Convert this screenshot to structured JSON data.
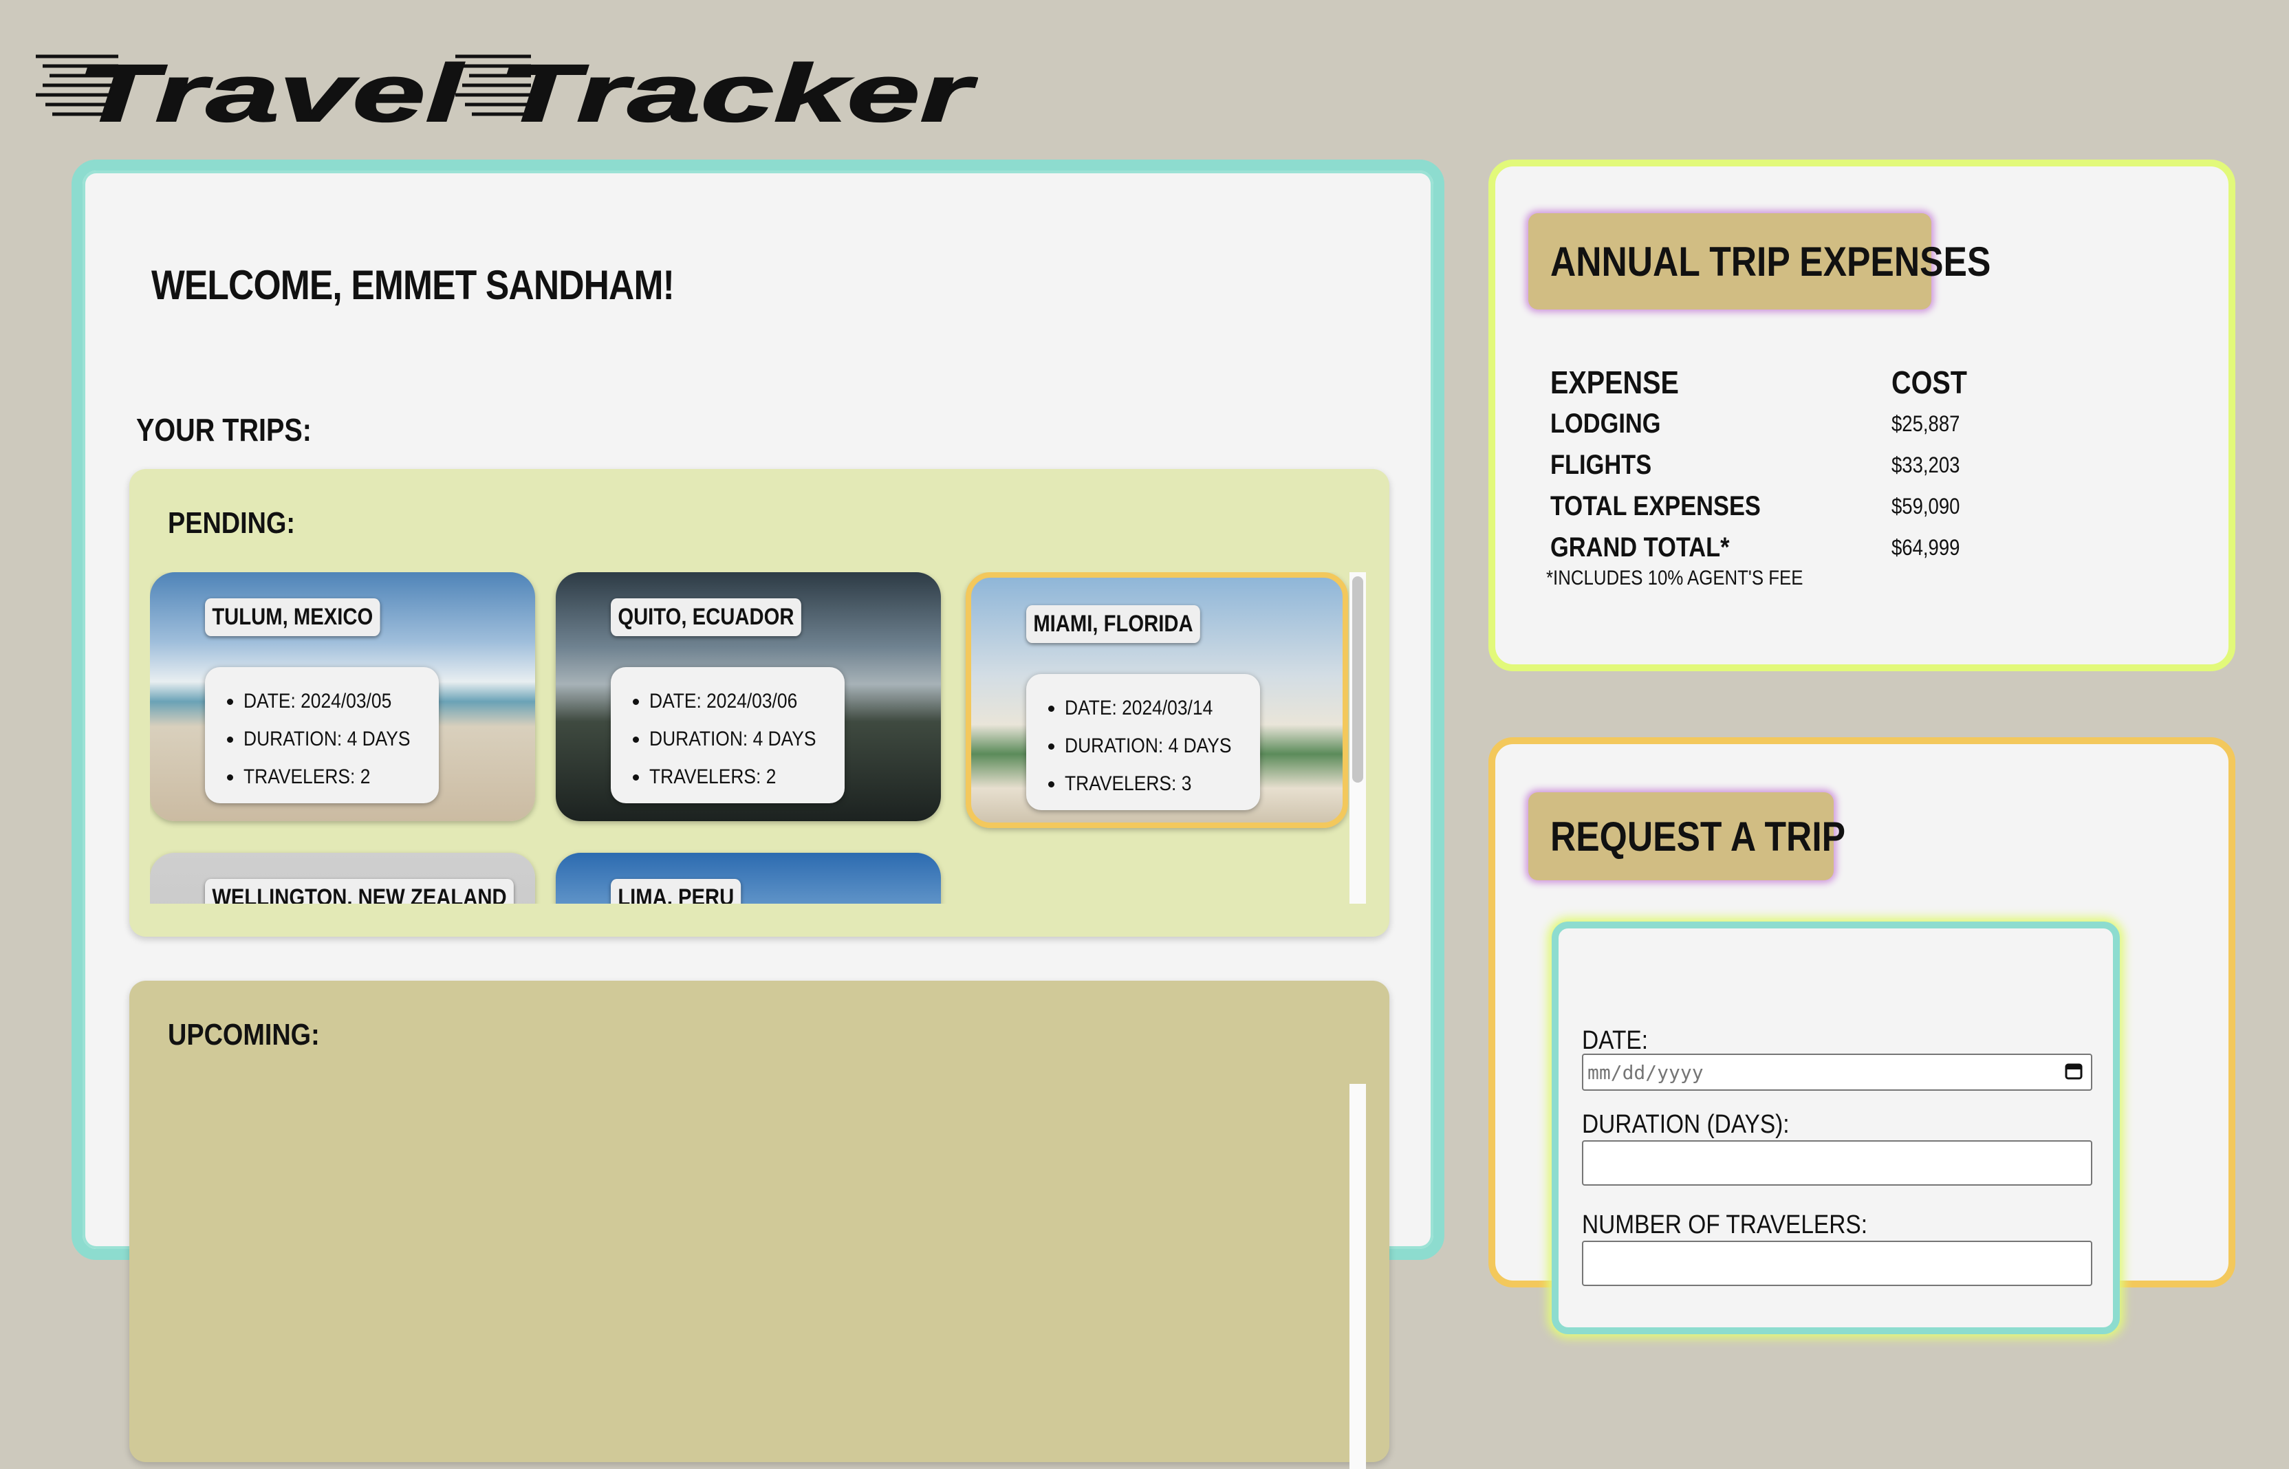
{
  "app": {
    "logo_text": "Travel Tracker"
  },
  "main": {
    "welcome": "WELCOME, EMMET SANDHAM!",
    "your_trips_heading": "YOUR TRIPS:",
    "pending": {
      "title": "PENDING:",
      "trips": [
        {
          "name": "TULUM, MEXICO",
          "date": "DATE: 2024/03/05",
          "duration": "DURATION: 4 DAYS",
          "travelers": "TRAVELERS: 2"
        },
        {
          "name": "QUITO, ECUADOR",
          "date": "DATE: 2024/03/06",
          "duration": "DURATION: 4 DAYS",
          "travelers": "TRAVELERS: 2"
        },
        {
          "name": "MIAMI, FLORIDA",
          "date": "DATE: 2024/03/14",
          "duration": "DURATION: 4 DAYS",
          "travelers": "TRAVELERS: 3"
        },
        {
          "name": "WELLINGTON, NEW ZEALAND"
        },
        {
          "name": "LIMA, PERU"
        }
      ]
    },
    "upcoming": {
      "title": "UPCOMING:"
    }
  },
  "expenses": {
    "title": "ANNUAL TRIP EXPENSES",
    "headers": [
      "EXPENSE",
      "COST"
    ],
    "rows": [
      {
        "label": "LODGING",
        "value": "$25,887"
      },
      {
        "label": "FLIGHTS",
        "value": "$33,203"
      },
      {
        "label": "TOTAL EXPENSES",
        "value": "$59,090"
      },
      {
        "label": "GRAND TOTAL*",
        "value": "$64,999"
      }
    ],
    "note": "*INCLUDES 10% AGENT'S FEE"
  },
  "request": {
    "title": "REQUEST A TRIP",
    "date_label": "DATE:",
    "date_placeholder": "mm/dd/yyyy",
    "duration_label": "DURATION (DAYS):",
    "travelers_label": "NUMBER OF TRAVELERS:"
  },
  "colors": {
    "background": "#cdc9bd",
    "main_border": "#8ddccf",
    "expenses_border": "#e2f97a",
    "request_border": "#f3c85c",
    "pending_panel": "#e3e9b6",
    "upcoming_panel": "#d0c998",
    "chip": "#d1bd83",
    "chip_glow": "#cf97dc"
  }
}
